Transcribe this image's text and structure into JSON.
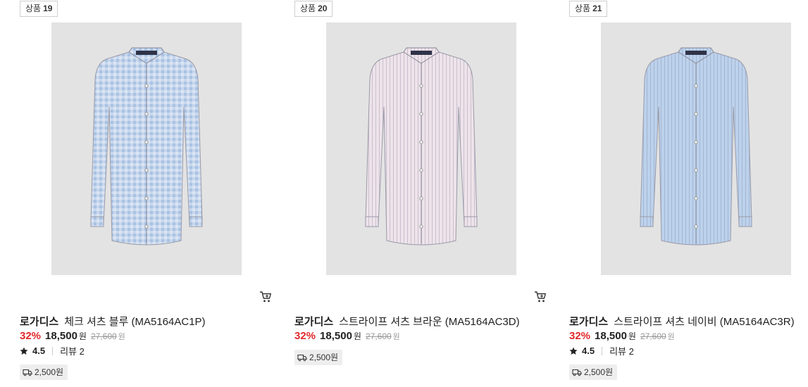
{
  "products": [
    {
      "badge_label": "상품",
      "badge_num": "19",
      "brand": "로가디스",
      "name": "체크 셔츠 블루 (MA5164AC1P)",
      "discount": "32%",
      "price": "18,500",
      "price_unit": "원",
      "original_price": "27,600",
      "original_unit": "원",
      "rating": "4.5",
      "review_label": "리뷰 2",
      "shipping": "2,500원",
      "shirt_color": "#a9c2e3",
      "pattern": "check"
    },
    {
      "badge_label": "상품",
      "badge_num": "20",
      "brand": "로가디스",
      "name": "스트라이프 셔츠 브라운 (MA5164AC3D)",
      "discount": "32%",
      "price": "18,500",
      "price_unit": "원",
      "original_price": "27,600",
      "original_unit": "원",
      "rating": "",
      "review_label": "",
      "shipping": "2,500원",
      "shirt_color": "#eee3ea",
      "pattern": "stripe"
    },
    {
      "badge_label": "상품",
      "badge_num": "21",
      "brand": "로가디스",
      "name": "스트라이프 셔츠 네이비 (MA5164AC3R)",
      "discount": "32%",
      "price": "18,500",
      "price_unit": "원",
      "original_price": "27,600",
      "original_unit": "원",
      "rating": "4.5",
      "review_label": "리뷰 2",
      "shipping": "2,500원",
      "shirt_color": "#bcd2ec",
      "pattern": "stripe"
    }
  ],
  "icons": {
    "cart": "cart-icon",
    "star": "star-icon",
    "truck": "truck-icon"
  },
  "colors": {
    "discount": "#e0282b",
    "thumb_bg": "#e3e3e3"
  }
}
